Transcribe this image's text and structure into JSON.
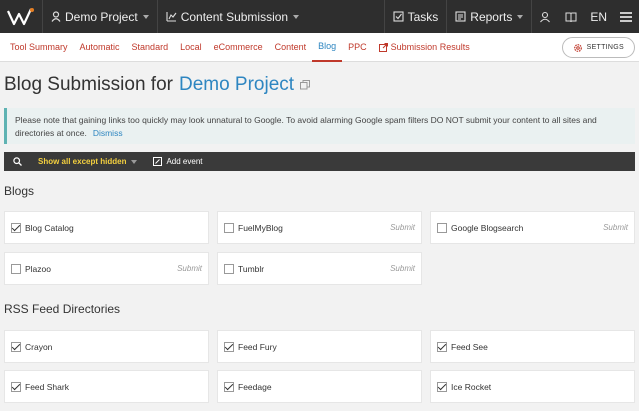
{
  "topbar": {
    "project": "Demo Project",
    "module": "Content Submission",
    "tasks": "Tasks",
    "reports": "Reports",
    "lang": "EN"
  },
  "tabs": [
    {
      "label": "Tool Summary"
    },
    {
      "label": "Automatic"
    },
    {
      "label": "Standard"
    },
    {
      "label": "Local"
    },
    {
      "label": "eCommerce"
    },
    {
      "label": "Content"
    },
    {
      "label": "Blog"
    },
    {
      "label": "PPC"
    },
    {
      "label": "Submission Results"
    }
  ],
  "settings_label": "SETTINGS",
  "page": {
    "title_prefix": "Blog Submission for",
    "title_project": "Demo Project"
  },
  "notice": {
    "text": "Please note that gaining links too quickly may look unnatural to Google. To avoid alarming Google spam filters DO NOT submit your content to all sites and directories at once.",
    "dismiss": "Dismiss"
  },
  "filterbar": {
    "filter": "Show all except hidden",
    "add_event": "Add event"
  },
  "sections": {
    "blogs": {
      "title": "Blogs",
      "items": [
        {
          "label": "Blog Catalog",
          "checked": true,
          "submit": ""
        },
        {
          "label": "FuelMyBlog",
          "checked": false,
          "submit": "Submit"
        },
        {
          "label": "Google Blogsearch",
          "checked": false,
          "submit": "Submit"
        },
        {
          "label": "Plazoo",
          "checked": false,
          "submit": "Submit"
        },
        {
          "label": "Tumblr",
          "checked": false,
          "submit": "Submit"
        }
      ]
    },
    "rss": {
      "title": "RSS Feed Directories",
      "items": [
        {
          "label": "Crayon",
          "checked": true,
          "submit": ""
        },
        {
          "label": "Feed Fury",
          "checked": true,
          "submit": ""
        },
        {
          "label": "Feed See",
          "checked": true,
          "submit": ""
        },
        {
          "label": "Feed Shark",
          "checked": true,
          "submit": ""
        },
        {
          "label": "Feedage",
          "checked": true,
          "submit": ""
        },
        {
          "label": "Ice Rocket",
          "checked": true,
          "submit": ""
        }
      ]
    }
  },
  "colors": {
    "topbar": "#2e2e2e",
    "tab_text": "#c0392b",
    "accent": "#2e86c1",
    "filter_highlight": "#f4d03f"
  }
}
